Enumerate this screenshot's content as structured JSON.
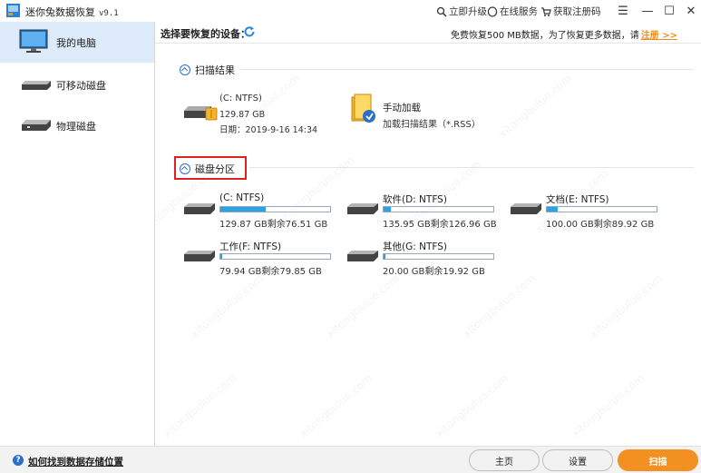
{
  "app": {
    "title": "迷你兔数据恢复",
    "version": "v9.1"
  },
  "titlebar": {
    "upgrade": "立即升级",
    "online_service": "在线服务",
    "get_code": "获取注册码",
    "menu_glyph": "☰",
    "minimize_glyph": "—",
    "maximize_glyph": "☐",
    "close_glyph": "✕"
  },
  "sidebar": {
    "items": [
      {
        "label": "我的电脑",
        "active": true
      },
      {
        "label": "可移动磁盘",
        "active": false
      },
      {
        "label": "物理磁盘",
        "active": false
      }
    ]
  },
  "topbar": {
    "select_device": "选择要恢复的设备：",
    "notice": "免费恢复500 MB数据，为了恢复更多数据，请",
    "register": "注册 >>"
  },
  "scan_results": {
    "heading": "扫描结果",
    "item": {
      "name": "(C: NTFS)",
      "size": "129.87 GB",
      "date": "日期：2019-9-16 14:34"
    },
    "manual": {
      "title": "手动加载",
      "subtitle": "加载扫描结果（*.RSS）"
    }
  },
  "partitions": {
    "heading": "磁盘分区",
    "items": [
      {
        "name": "(C: NTFS)",
        "usage": "129.87 GB剩余76.51 GB",
        "fill": 0.41
      },
      {
        "name": "软件(D: NTFS)",
        "usage": "135.95 GB剩余126.96 GB",
        "fill": 0.07
      },
      {
        "name": "文档(E: NTFS)",
        "usage": "100.00 GB剩余89.92 GB",
        "fill": 0.1
      },
      {
        "name": "工作(F: NTFS)",
        "usage": "79.94 GB剩余79.85 GB",
        "fill": 0.002
      },
      {
        "name": "其他(G: NTFS)",
        "usage": "20.00 GB剩余19.92 GB",
        "fill": 0.004
      }
    ]
  },
  "footer": {
    "help_link": "如何找到数据存储位置",
    "home": "主页",
    "settings": "设置",
    "scan": "扫描"
  },
  "colors": {
    "accent": "#f39022",
    "progress": "#2aa2e6",
    "highlight": "#e02020",
    "selected_bg": "#dceafa"
  }
}
